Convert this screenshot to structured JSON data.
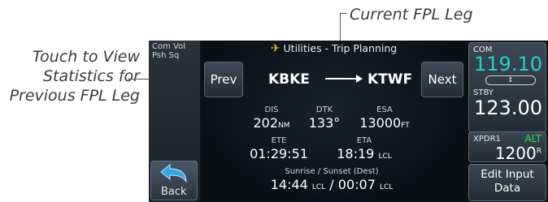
{
  "callouts": {
    "current_leg": "Current FPL Leg",
    "prev_stats_line1": "Touch to View",
    "prev_stats_line2": "Statistics for",
    "prev_stats_line3": "Previous FPL Leg"
  },
  "left_bar": {
    "com_vol_line1": "Com Vol",
    "com_vol_line2": "Psh Sq",
    "back_label": "Back"
  },
  "header": {
    "title": "Utilities - Trip Planning",
    "icon": "airplane-icon"
  },
  "nav": {
    "prev_label": "Prev",
    "next_label": "Next"
  },
  "route": {
    "from": "KBKE",
    "to": "KTWF"
  },
  "stats": {
    "dis_label": "DIS",
    "dis_value": "202",
    "dis_unit": "NM",
    "dtk_label": "DTK",
    "dtk_value": "133°",
    "esa_label": "ESA",
    "esa_value": "13000",
    "esa_unit": "FT",
    "ete_label": "ETE",
    "ete_value": "01:29:51",
    "eta_label": "ETA",
    "eta_value": "18:19",
    "eta_unit": "LCL",
    "sun_label": "Sunrise / Sunset (Dest)",
    "sunrise_value": "14:44",
    "sunset_value": "00:07",
    "sun_unit": "LCL"
  },
  "radio": {
    "com_label": "COM",
    "com_active": "119.10",
    "stby_label": "STBY",
    "com_standby": "123.00",
    "xpdr_label": "XPDR1",
    "xpdr_mode": "ALT",
    "xpdr_code": "1200",
    "xpdr_suffix": "R",
    "edit_line1": "Edit Input",
    "edit_line2": "Data"
  },
  "colors": {
    "active_freq": "#22d3c4",
    "standby": "#ffffff",
    "xpdr_mode": "#22e040",
    "icon_yellow": "#e8c020"
  }
}
